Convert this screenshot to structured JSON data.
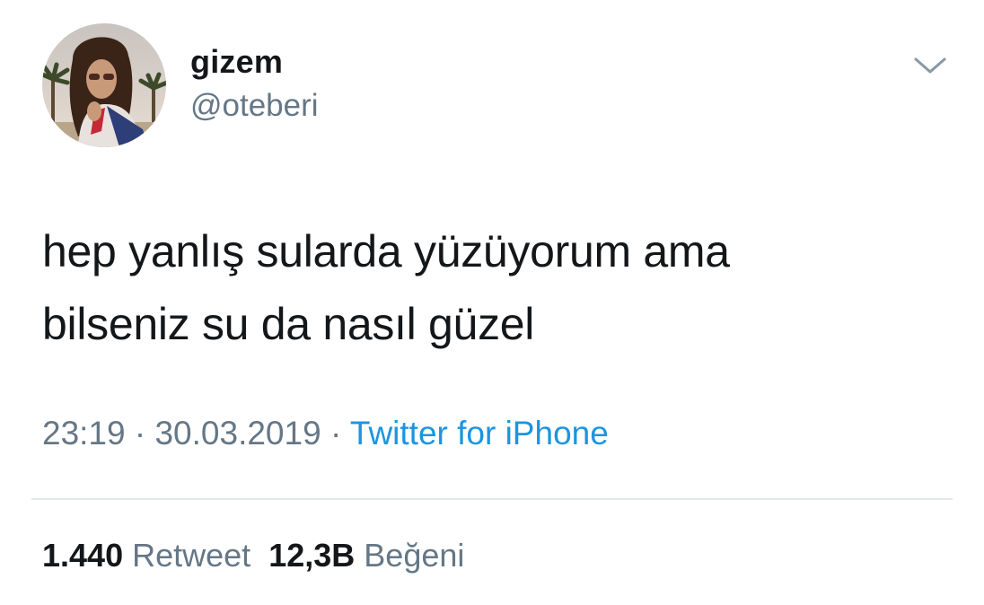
{
  "author": {
    "display_name": "gizem",
    "handle": "@oteberi"
  },
  "tweet": {
    "lines": [
      "hep yanlış sularda yüzüyorum ama",
      "bilseniz su da nasıl güzel"
    ],
    "time": "23:19",
    "separator": " · ",
    "date": "30.03.2019",
    "source": "Twitter for iPhone"
  },
  "stats": {
    "retweets_count": "1.440",
    "retweets_label": "Retweet",
    "likes_count": "12,3B",
    "likes_label": "Beğeni"
  },
  "icons": {
    "menu": "chevron-down-icon"
  },
  "colors": {
    "text_primary": "#14171a",
    "text_secondary": "#657786",
    "link": "#1b95e0",
    "divider": "#e1e8ed"
  }
}
